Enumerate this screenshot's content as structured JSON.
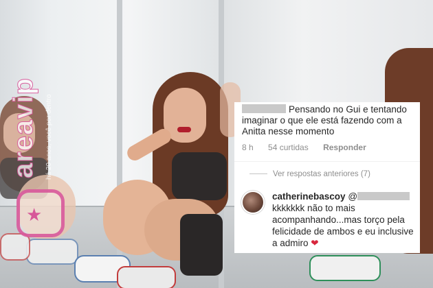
{
  "watermark": {
    "brand": "areavip",
    "tagline": "há 20 anos, você por dentro"
  },
  "comment_top": {
    "text": "Pensando no Gui e tentando imaginar o que ele está fazendo com a Anitta nesse momento",
    "time": "8 h",
    "likes": "54 curtidas",
    "reply_label": "Responder"
  },
  "comment_reply": {
    "view_previous": "Ver respostas anteriores (7)",
    "username": "catherinebascoy",
    "mention_prefix": "@",
    "text": "kkkkkkk não to mais acompanhando...mas torço pela felicidade de ambos e eu inclusive a admiro",
    "heart": "❤"
  },
  "colors": {
    "brand_pink": "#d650a0",
    "heart_red": "#d7263d",
    "text_dark": "#262626",
    "text_muted": "#8e8e8e"
  }
}
